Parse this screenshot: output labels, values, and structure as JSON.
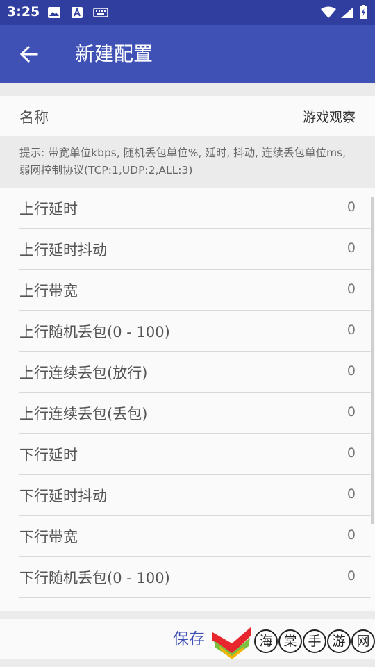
{
  "status_bar": {
    "time": "3:25",
    "left_icons": [
      "image-icon",
      "a-icon",
      "keyboard-icon"
    ],
    "right_icons": [
      "wifi-icon",
      "signal-icon",
      "battery-icon"
    ]
  },
  "app_bar": {
    "title": "新建配置",
    "back_icon": "arrow-left-icon"
  },
  "name_row": {
    "label": "名称",
    "value": "游戏观察"
  },
  "hint": "提示: 带宽单位kbps, 随机丢包单位%, 延时, 抖动, 连续丢包单位ms, 弱网控制协议(TCP:1,UDP:2,ALL:3)",
  "settings": [
    {
      "label": "上行延时",
      "value": "0"
    },
    {
      "label": "上行延时抖动",
      "value": "0"
    },
    {
      "label": "上行带宽",
      "value": "0"
    },
    {
      "label": "上行随机丢包(0 - 100)",
      "value": "0"
    },
    {
      "label": "上行连续丢包(放行)",
      "value": "0"
    },
    {
      "label": "上行连续丢包(丢包)",
      "value": "0"
    },
    {
      "label": "下行延时",
      "value": "0"
    },
    {
      "label": "下行延时抖动",
      "value": "0"
    },
    {
      "label": "下行带宽",
      "value": "0"
    },
    {
      "label": "下行随机丢包(0 - 100)",
      "value": "0"
    }
  ],
  "save_label": "保存",
  "watermark": {
    "chars": [
      "海",
      "棠",
      "手",
      "游",
      "网"
    ]
  },
  "colors": {
    "status_bar": "#303f9f",
    "app_bar": "#3f51b5",
    "accent": "#3f51b5"
  }
}
